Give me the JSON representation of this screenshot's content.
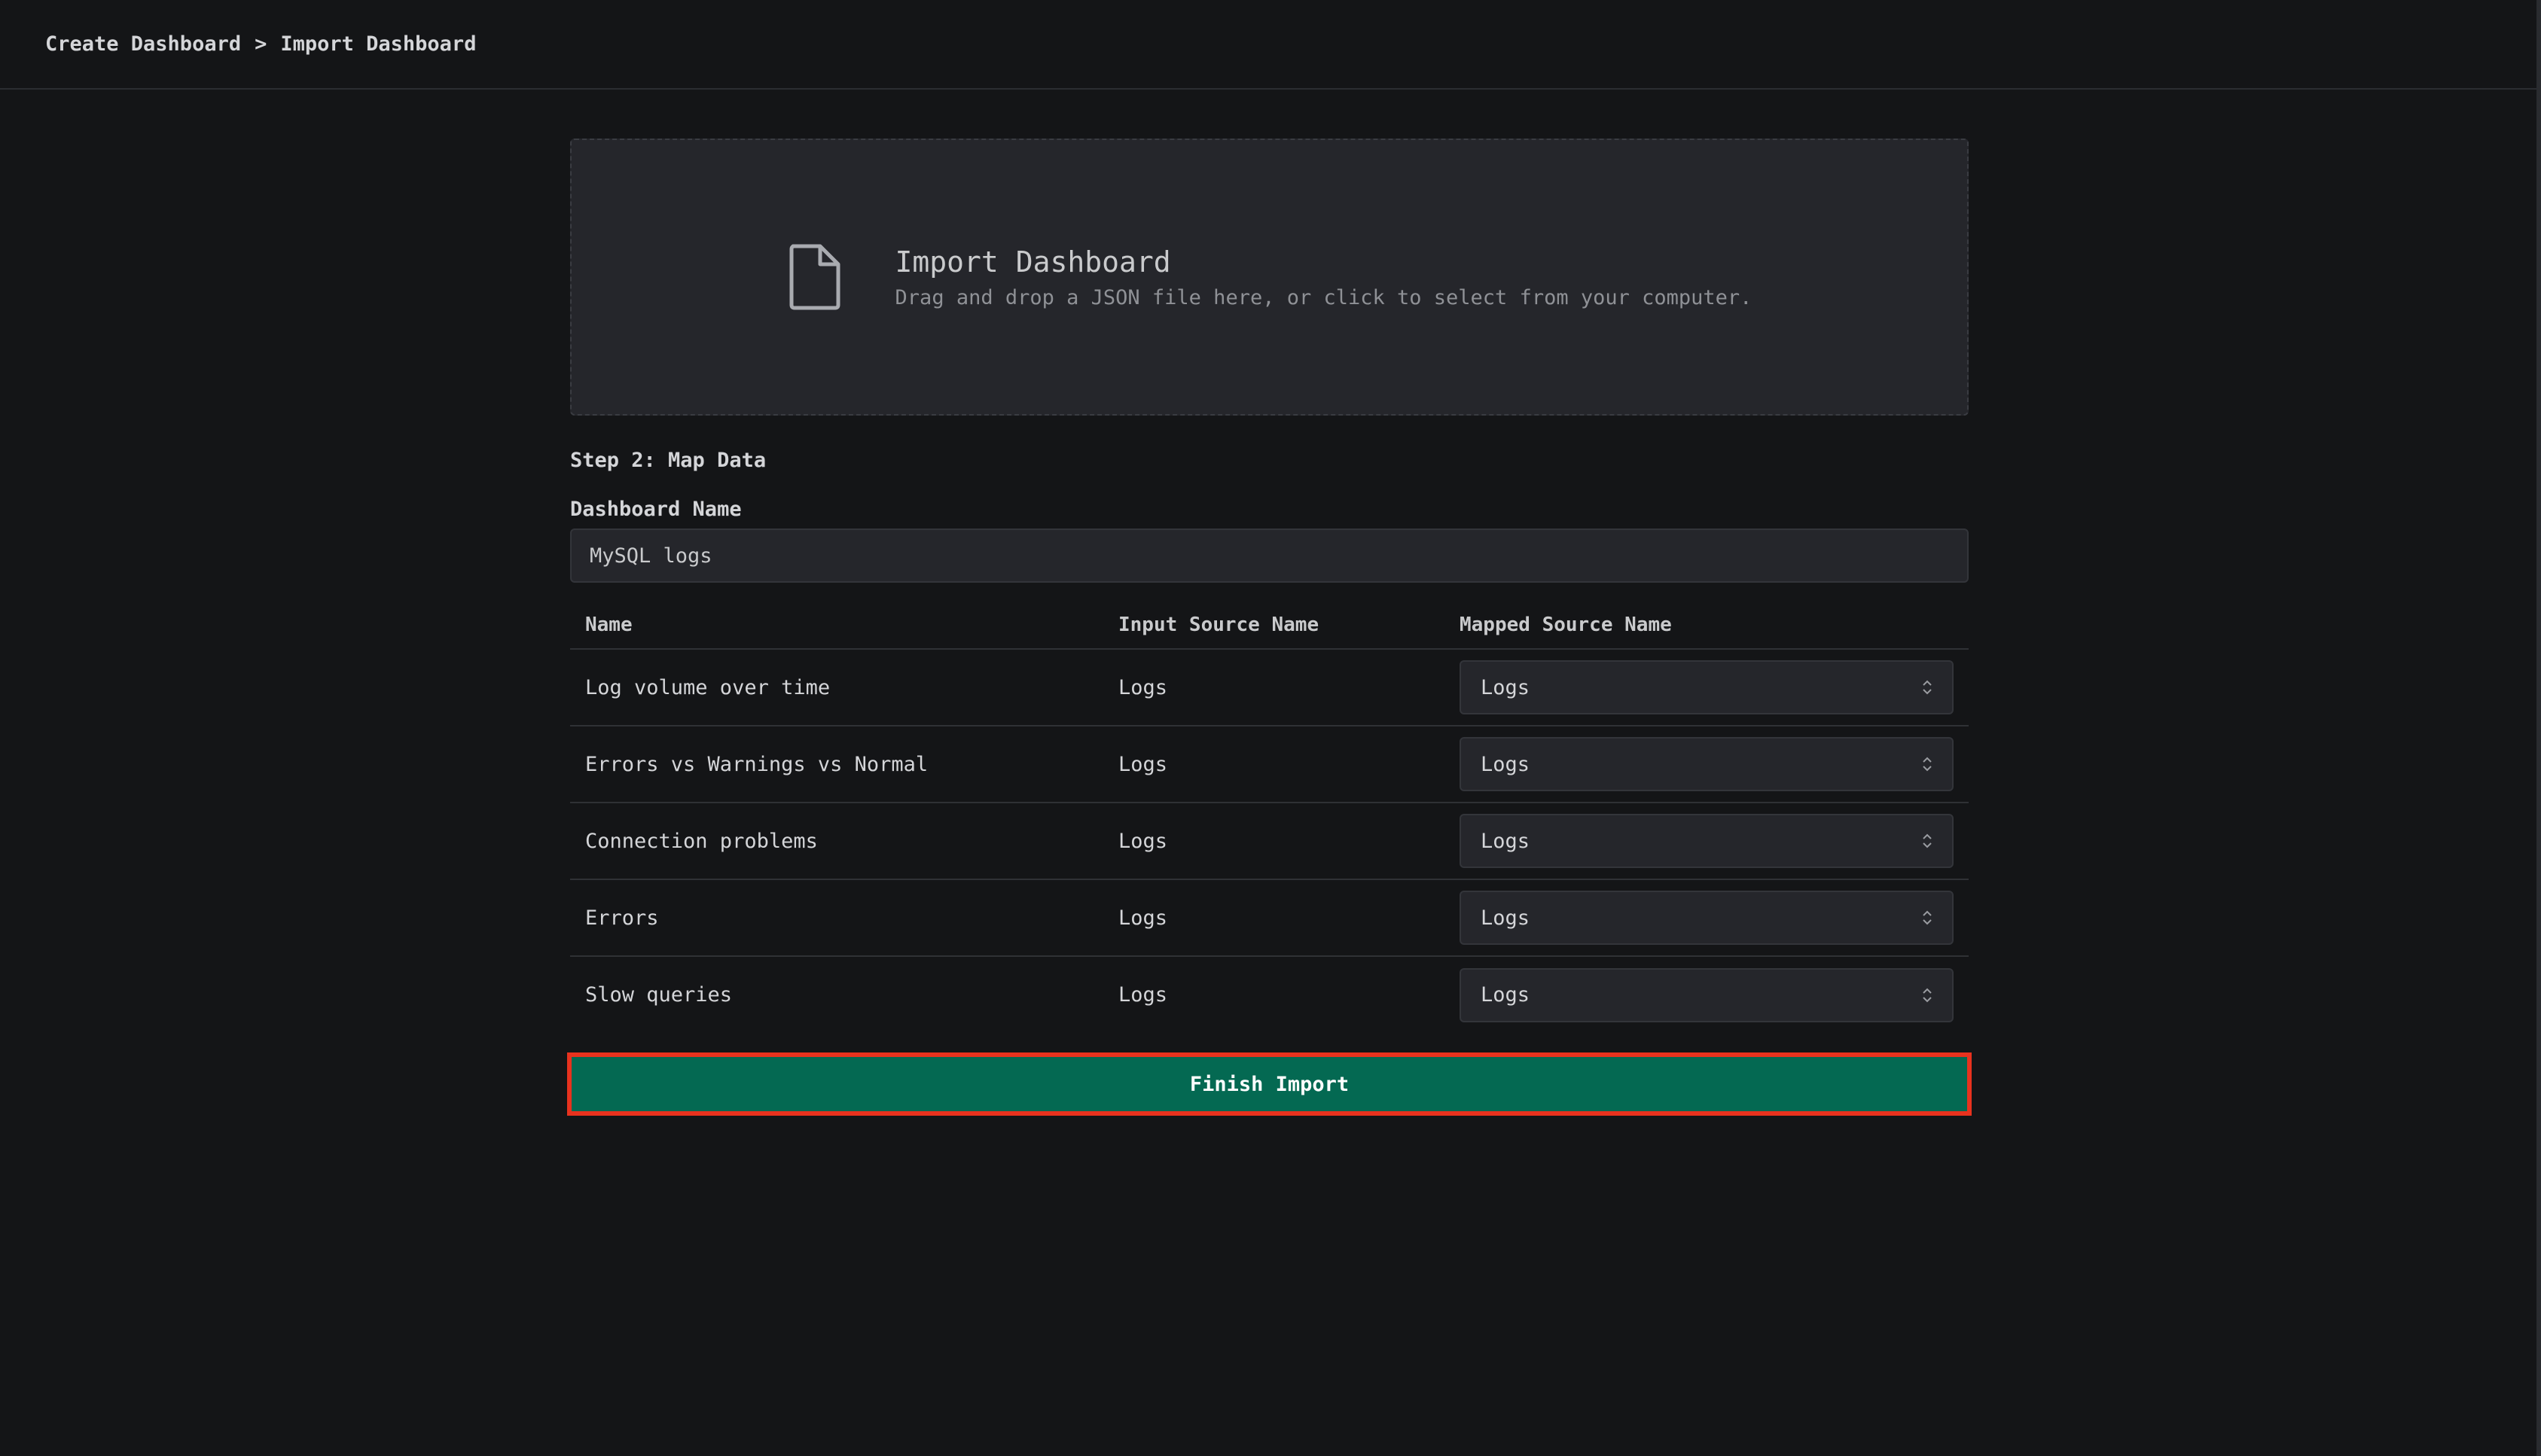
{
  "breadcrumb": {
    "parent": "Create Dashboard",
    "separator": ">",
    "current": "Import Dashboard"
  },
  "dropzone": {
    "icon": "file-icon",
    "title": "Import Dashboard",
    "subtitle": "Drag and drop a JSON file here, or click to select from your computer."
  },
  "step": {
    "title": "Step 2: Map Data"
  },
  "dashboard_name": {
    "label": "Dashboard Name",
    "value": "MySQL logs"
  },
  "table": {
    "headers": [
      "Name",
      "Input Source Name",
      "Mapped Source Name"
    ],
    "rows": [
      {
        "name": "Log volume over time",
        "input": "Logs",
        "mapped": "Logs"
      },
      {
        "name": "Errors vs Warnings vs Normal",
        "input": "Logs",
        "mapped": "Logs"
      },
      {
        "name": "Connection problems",
        "input": "Logs",
        "mapped": "Logs"
      },
      {
        "name": "Errors",
        "input": "Logs",
        "mapped": "Logs"
      },
      {
        "name": "Slow queries",
        "input": "Logs",
        "mapped": "Logs"
      }
    ]
  },
  "finish_button": {
    "label": "Finish Import",
    "color": "#046952",
    "highlight_color": "#e8321e"
  }
}
